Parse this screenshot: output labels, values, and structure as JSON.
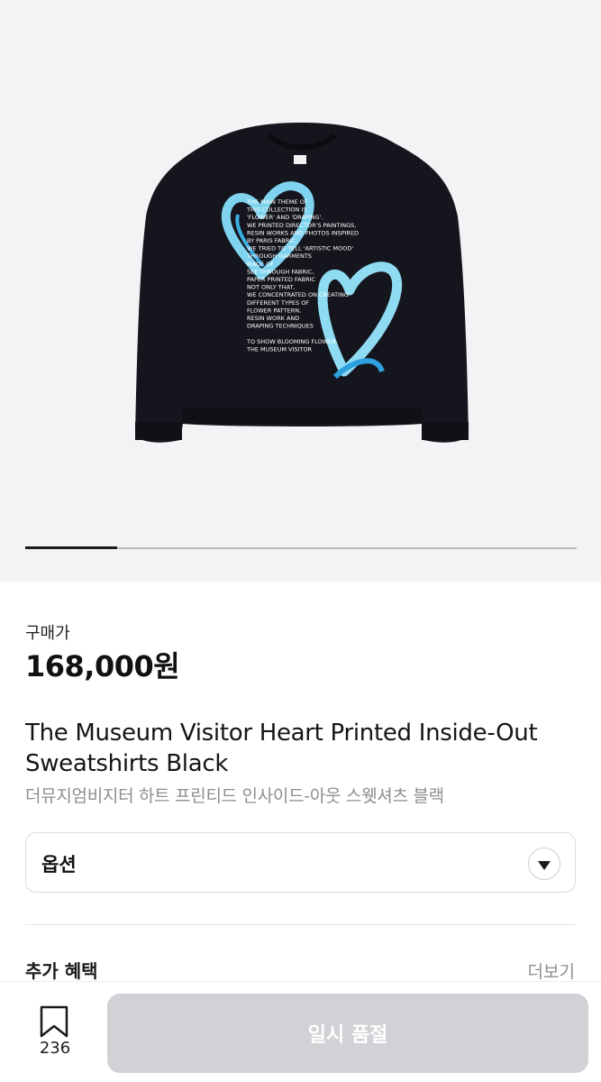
{
  "gallery": {
    "image_description": "",
    "print_lines": [
      "THE MAIN THEME OF",
      "THIS COLLECTION IS",
      "'FLOWER' AND 'DRAPING'.",
      "WE PRINTED DIRECTOR'S PAINTINGS,",
      "RESIN WORKS AND PHOTOS INSPIRED",
      "BY PARIS FABRIC.",
      "WE TRIED TO TELL 'ARTISTIC MOOD'",
      "THROUGH GARMENTS",
      "MADE OF",
      "SEE-THROUGH FABRIC,",
      "PAPER PRINTED FABRIC",
      "NOT ONLY THAT,",
      "WE CONCENTRATED ON CREATING",
      "DIFFERENT TYPES OF",
      "FLOWER PATTERN,",
      "RESIN WORK AND",
      "DRAPING TECHNIQUES",
      "",
      "TO SHOW BLOOMING FLOWER.",
      "THE MUSEUM VISITOR"
    ],
    "progress": 0.166,
    "colors": {
      "background": "#f3f3f5",
      "garment": "#15151d",
      "heart": "#7fd3ee",
      "heart_dark": "#2ea0dd"
    }
  },
  "price": {
    "label": "구매가",
    "amount": "168,000원"
  },
  "product": {
    "title_en": "The Museum Visitor Heart Printed Inside-Out Sweatshirts Black",
    "title_ko": "더뮤지엄비지터 하트 프린티드 인사이드-아웃 스웻셔츠 블랙"
  },
  "option": {
    "label": "옵션",
    "icon": "chevron-down-icon"
  },
  "benefits": {
    "title": "추가 혜택",
    "more": "더보기"
  },
  "bottom_bar": {
    "bookmark_icon": "bookmark-icon",
    "bookmark_count": "236",
    "action_label": "일시 품절",
    "action_color": "#d2d2d6"
  }
}
